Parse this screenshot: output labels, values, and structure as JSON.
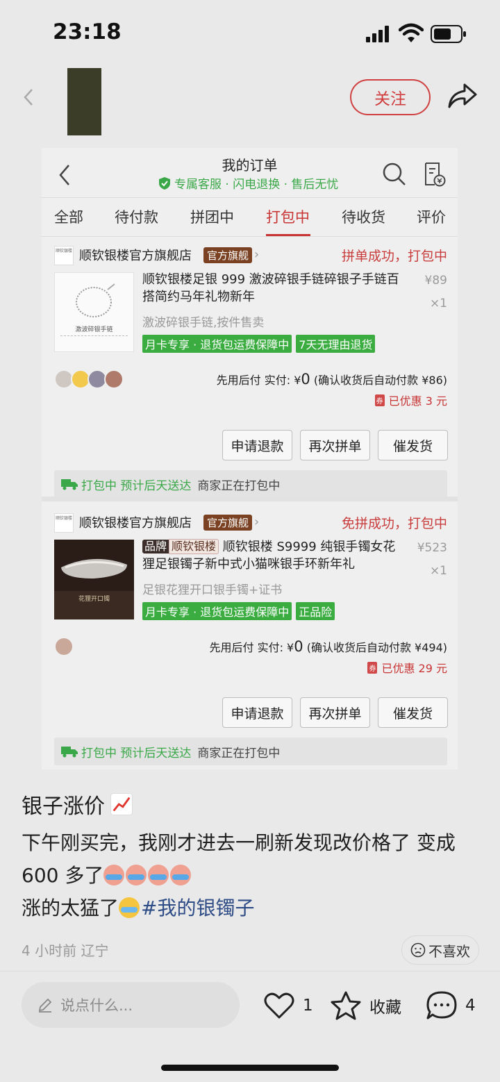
{
  "status_bar": {
    "time": "23:18"
  },
  "header": {
    "follow_label": "关注"
  },
  "orders_page": {
    "title": "我的订单",
    "subtitle": "专属客服 · 闪电退换 · 售后无忧",
    "tabs": [
      "全部",
      "待付款",
      "拼团中",
      "打包中",
      "待收货",
      "评价"
    ],
    "active_tab": "打包中"
  },
  "orders": [
    {
      "shop_logo_text": "顺钦银楼",
      "shop_name": "顺钦银楼官方旗舰店",
      "shop_flag": "官方旗舰",
      "status": "拼单成功，打包中",
      "thumb_caption": "激波碎银手链",
      "product_title": "顺钦银楼足银 999 激波碎银手链碎银子手链百搭简约马年礼物新年",
      "price": "¥89",
      "qty": "×1",
      "spec": "激波碎银手链,按件售卖",
      "tags": [
        "月卡专享 · 退货包运费保障中",
        "7天无理由退货"
      ],
      "pay_prefix": "先用后付  实付: ¥",
      "pay_amount": "0",
      "pay_suffix": " (确认收货后自动付款 ¥86)",
      "discount_badge": "券",
      "discount": "已优惠 3 元",
      "buttons": [
        "申请退款",
        "再次拼单",
        "催发货"
      ],
      "info_green": "打包中 预计后天送达",
      "info_dark": "商家正在打包中"
    },
    {
      "shop_logo_text": "顺钦银楼",
      "shop_name": "顺钦银楼官方旗舰店",
      "shop_flag": "官方旗舰",
      "status": "免拼成功，打包中",
      "thumb_caption": "花狸开口镯",
      "brand_tag": "品牌",
      "brand_name": "顺钦银楼",
      "product_title": " 顺钦银楼 S9999 纯银手镯女花狸足银镯子新中式小猫咪银手环新年礼",
      "price": "¥523",
      "qty": "×1",
      "spec": "足银花狸开口银手镯+证书",
      "tags": [
        "月卡专享 · 退货包运费保障中",
        "正品险"
      ],
      "pay_prefix": "先用后付  实付: ¥",
      "pay_amount": "0",
      "pay_suffix": " (确认收货后自动付款 ¥494)",
      "discount_badge": "券",
      "discount": "已优惠 29 元",
      "buttons": [
        "申请退款",
        "再次拼单",
        "催发货"
      ],
      "info_green": "打包中 预计后天送达",
      "info_dark": "商家正在打包中"
    }
  ],
  "post": {
    "title": "银子涨价",
    "line1": "下午刚买完，我刚才进去一刷新发现改价格了 变成",
    "line2": "600 多了",
    "line3": "涨的太猛了",
    "hashtag": "#我的银镯子",
    "meta": "4 小时前  辽宁",
    "dislike": "不喜欢"
  },
  "bottom_bar": {
    "comment_placeholder": "说点什么...",
    "like_count": "1",
    "collect_label": "收藏",
    "comment_count": "4"
  },
  "colors": {
    "accent_red": "#c83434",
    "green": "#3aac40",
    "brand_brown": "#7a4222"
  },
  "icons": [
    "back-icon",
    "share-icon",
    "search-icon",
    "receipt-icon",
    "shield-icon",
    "truck-icon",
    "heart-icon",
    "star-icon",
    "comment-icon",
    "pen-icon"
  ]
}
